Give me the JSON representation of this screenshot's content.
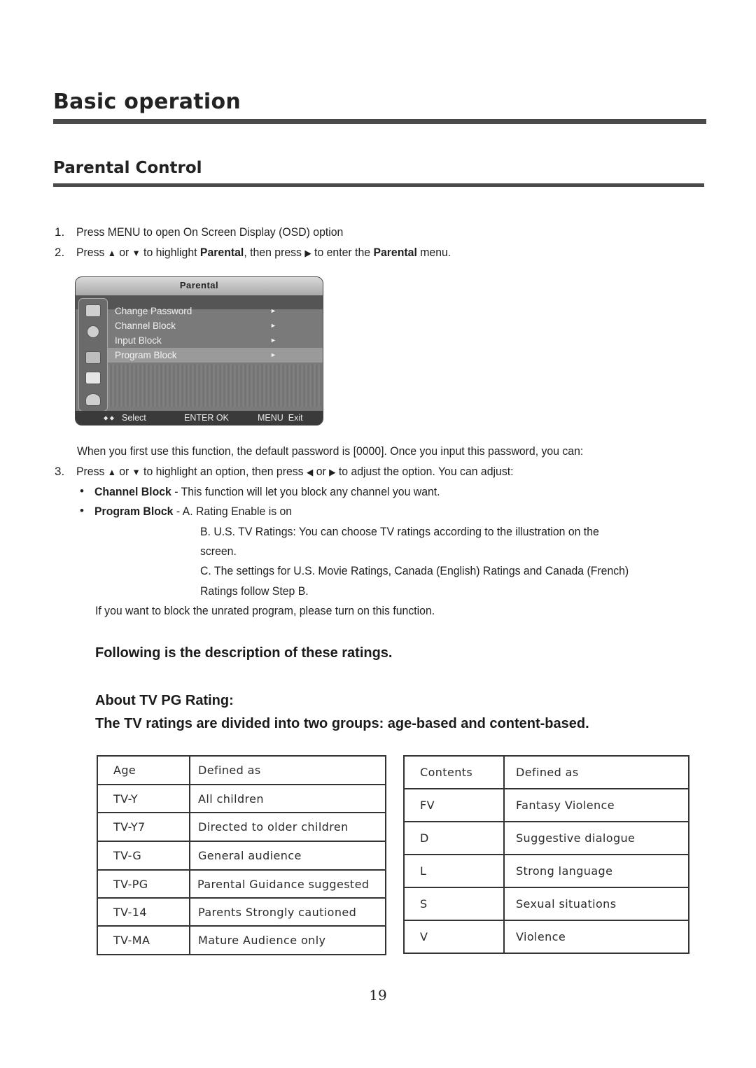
{
  "section_title": "Basic operation",
  "subsection_title": "Parental Control",
  "steps": [
    {
      "num": "1.",
      "text": "Press MENU to open On Screen Display (OSD) option"
    },
    {
      "num": "2.",
      "pre": "Press",
      "up": "▲",
      "or": "or",
      "down": "▼",
      "mid1": "to highlight",
      "bold1": "Parental",
      "mid2": ", then press",
      "right": "▶",
      "mid3": "to enter the",
      "bold2": "Parental",
      "post": "menu."
    }
  ],
  "osd": {
    "title": "Parental",
    "items": [
      {
        "label": "Change Password",
        "arrow": "►"
      },
      {
        "label": "Channel Block",
        "arrow": "►"
      },
      {
        "label": "Input Block",
        "arrow": "►"
      },
      {
        "label": "Program Block",
        "arrow": "►"
      }
    ],
    "side_icons": [
      "picture-icon",
      "sound-icon",
      "setup-icon",
      "parental-lock-icon",
      "channel-dish-icon"
    ],
    "footer": {
      "select": "Select",
      "select_glyph": "⬥ ⬥",
      "enter": "ENTER OK",
      "menu": "MENU  Exit"
    }
  },
  "password_note": "When you first use this function, the default password is [0000]. Once you input this password, you can:",
  "step3": {
    "num": "3.",
    "pre": "Press",
    "up": "▲",
    "or": "or",
    "down": "▼",
    "mid1": "to highlight an option, then press",
    "left": "◀",
    "or2": "or",
    "right": "▶",
    "post": "to adjust the option. You can adjust:"
  },
  "bullets": {
    "channel_block": {
      "label": "Channel Block",
      "text": " - This function will let you block any channel you want."
    },
    "program_block": {
      "label": "Program Block",
      "text": " - A. Rating Enable is on",
      "b_line1": "B. U.S. TV Ratings:   You can choose TV ratings according to the illustration on the",
      "b_line2": "screen.",
      "c_line1": "C. The settings for U.S. Movie Ratings, Canada (English) Ratings and Canada (French)",
      "c_line2": "Ratings follow Step B."
    }
  },
  "unrated_note": "If you want to block the unrated program, please turn on this function.",
  "ratings_intro": "Following is the description of these ratings.",
  "about_title": "About TV PG Rating:",
  "groups_line": "The TV ratings are divided into two groups: age-based and content-based.",
  "age_table": {
    "headers": [
      "Age",
      "Defined as"
    ],
    "rows": [
      [
        "TV-Y",
        "All children"
      ],
      [
        "TV-Y7",
        "Directed to older children"
      ],
      [
        "TV-G",
        "General audience"
      ],
      [
        "TV-PG",
        "Parental Guidance suggested"
      ],
      [
        "TV-14",
        "Parents Strongly cautioned"
      ],
      [
        "TV-MA",
        "Mature Audience only"
      ]
    ]
  },
  "content_table": {
    "headers": [
      "Contents",
      "Defined as"
    ],
    "rows": [
      [
        "FV",
        "Fantasy Violence"
      ],
      [
        "D",
        "Suggestive dialogue"
      ],
      [
        "L",
        "Strong language"
      ],
      [
        "S",
        "Sexual situations"
      ],
      [
        "V",
        "Violence"
      ]
    ]
  },
  "page_number": "19"
}
